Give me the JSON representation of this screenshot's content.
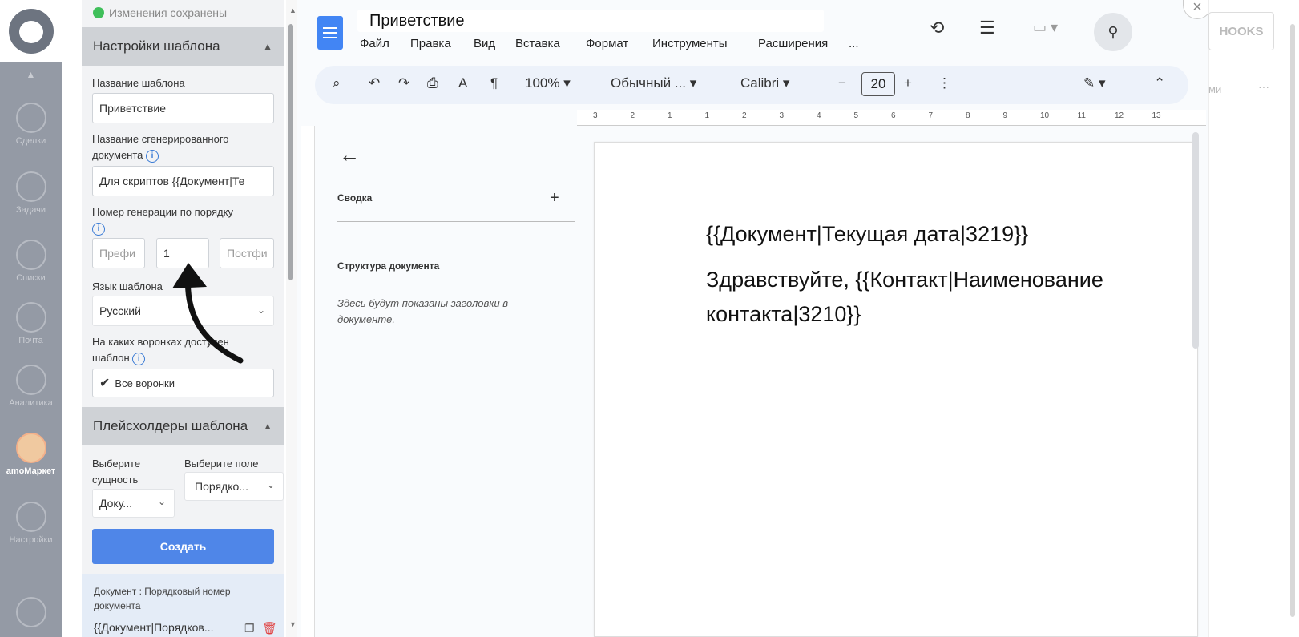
{
  "nav": {
    "items": [
      {
        "label": "Сделки"
      },
      {
        "label": "Задачи"
      },
      {
        "label": "Списки"
      },
      {
        "label": "Почта"
      },
      {
        "label": "Аналитика"
      },
      {
        "label": "amoМаркет"
      },
      {
        "label": "Настройки"
      }
    ]
  },
  "panel": {
    "status": "Изменения сохранены",
    "template_settings": {
      "title": "Настройки шаблона",
      "name_label": "Название шаблона",
      "name_value": "Приветствие",
      "docname_label": "Название сгенерированного документа",
      "docname_value": "Для скриптов {{Документ|Те",
      "gen_label": "Номер генерации по порядку",
      "prefix_placeholder": "Префи",
      "gen_value": "1",
      "postfix_placeholder": "Постфи",
      "lang_label": "Язык шаблона",
      "lang_value": "Русский",
      "funnels_label": "На каких воронках доступен шаблон",
      "funnels_value": "Все воронки"
    },
    "placeholders": {
      "title": "Плейсхолдеры шаблона",
      "entity_label": "Выберите сущность",
      "entity_value": "Доку...",
      "field_label": "Выберите поле",
      "field_value": "Порядко...",
      "create_label": "Создать",
      "item_title": "Документ : Порядковый номер документа",
      "item_code": "{{Документ|Порядков..."
    }
  },
  "docs": {
    "title": "Приветствие",
    "menu": [
      "Файл",
      "Правка",
      "Вид",
      "Вставка",
      "Формат",
      "Инструменты",
      "Расширения",
      "..."
    ],
    "zoom": "100%",
    "style": "Обычный ...",
    "font": "Calibri",
    "font_size": "20",
    "outline": {
      "summary": "Сводка",
      "structure": "Структура документа",
      "empty_hint": "Здесь будут показаны заголовки в документе."
    },
    "ruler": [
      "3",
      "2",
      "1",
      "1",
      "2",
      "3",
      "4",
      "5",
      "6",
      "7",
      "8",
      "9",
      "10",
      "11",
      "12",
      "13"
    ],
    "body": {
      "line1": "{{Документ|Текущая дата|3219}}",
      "line2": "Здравствуйте, {{Контакт|Наименование",
      "line3": "контакта|3210}}"
    }
  },
  "right": {
    "hooks": "HOOKS",
    "tab": "ми"
  }
}
